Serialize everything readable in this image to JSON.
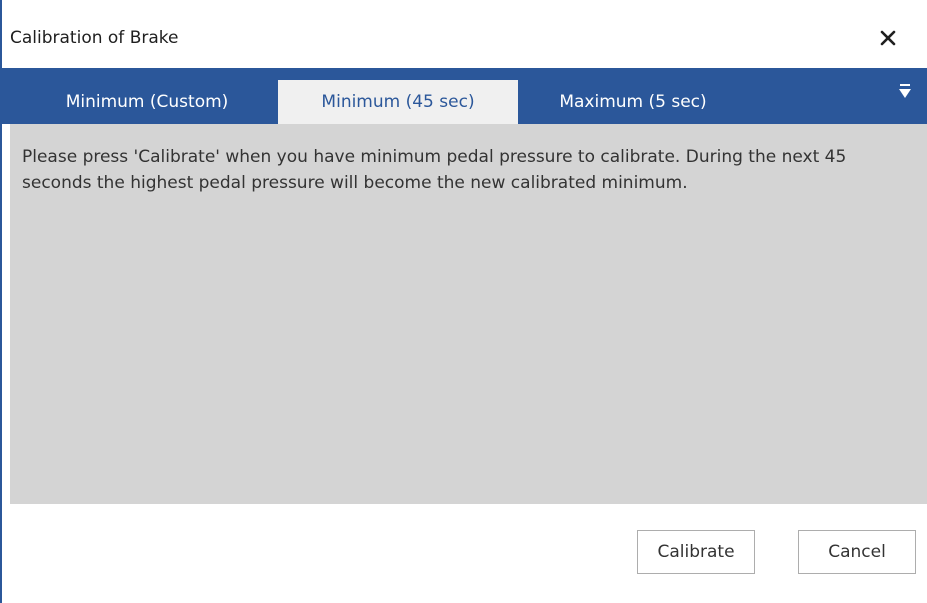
{
  "dialog": {
    "title": "Calibration of Brake",
    "close_label": "✕"
  },
  "tabs": [
    {
      "label": "Minimum (Custom)",
      "active": false
    },
    {
      "label": "Minimum (45 sec)",
      "active": true
    },
    {
      "label": "Maximum (5 sec)",
      "active": false
    }
  ],
  "content": {
    "message": "Please press 'Calibrate' when you have minimum pedal pressure to calibrate. During the next 45 seconds the highest pedal pressure will become the new calibrated minimum."
  },
  "buttons": {
    "calibrate_label": "Calibrate",
    "cancel_label": "Cancel"
  },
  "colors": {
    "accent": "#2b579a",
    "content_bg": "#d4d4d4",
    "active_tab_bg": "#f0f0f0"
  },
  "icons": {
    "close": "close-icon",
    "overflow": "chevron-down-icon"
  }
}
